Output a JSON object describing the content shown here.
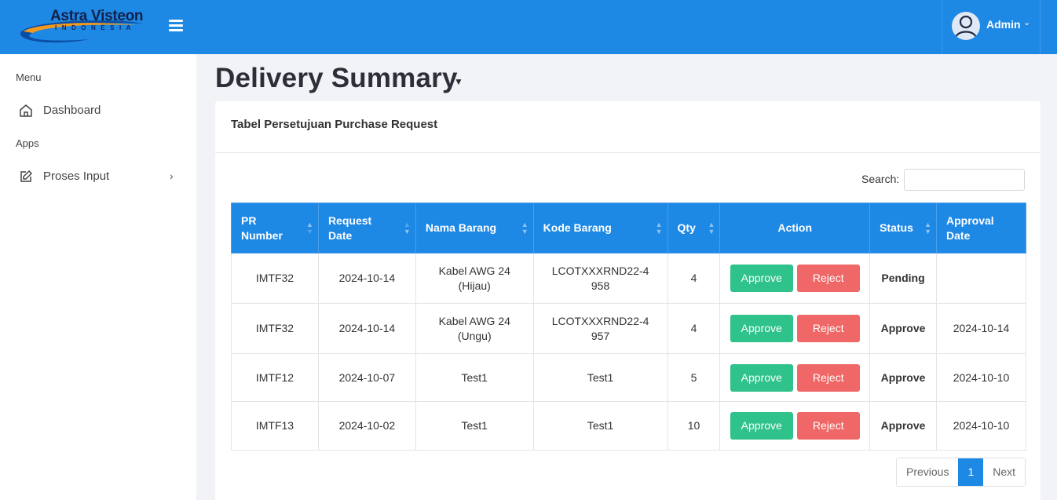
{
  "brand": {
    "name": "Astra Visteon",
    "sub": "INDONESIA"
  },
  "header": {
    "user": "Admin",
    "user_caret": "⌄"
  },
  "sidebar": {
    "menu_header": "Menu",
    "apps_header": "Apps",
    "items": [
      {
        "label": "Dashboard",
        "icon": "home-icon"
      },
      {
        "label": "Proses Input",
        "icon": "edit-icon",
        "chevron": "›"
      }
    ]
  },
  "page": {
    "title": "Delivery Summary",
    "title_caret": "▼"
  },
  "card": {
    "title": "Tabel Persetujuan Purchase Request",
    "search_label": "Search:",
    "search_value": ""
  },
  "table": {
    "columns": [
      {
        "label": "PR Number"
      },
      {
        "label": "Request Date"
      },
      {
        "label": "Nama Barang"
      },
      {
        "label": "Kode Barang"
      },
      {
        "label": "Qty"
      },
      {
        "label": "Action"
      },
      {
        "label": "Status"
      },
      {
        "label": "Approval Date"
      }
    ],
    "rows": [
      {
        "pr": "IMTF32",
        "date": "2024-10-14",
        "nama": "Kabel AWG 24 (Hijau)",
        "kode": "LCOTXXXRND22-4958",
        "qty": "4",
        "approve": "Approve",
        "reject": "Reject",
        "status": "Pending",
        "status_type": "pending",
        "approval_date": ""
      },
      {
        "pr": "IMTF32",
        "date": "2024-10-14",
        "nama": "Kabel AWG 24 (Ungu)",
        "kode": "LCOTXXXRND22-4957",
        "qty": "4",
        "approve": "Approve",
        "reject": "Reject",
        "status": "Approve",
        "status_type": "approve",
        "approval_date": "2024-10-14"
      },
      {
        "pr": "IMTF12",
        "date": "2024-10-07",
        "nama": "Test1",
        "kode": "Test1",
        "qty": "5",
        "approve": "Approve",
        "reject": "Reject",
        "status": "Approve",
        "status_type": "approve",
        "approval_date": "2024-10-10"
      },
      {
        "pr": "IMTF13",
        "date": "2024-10-02",
        "nama": "Test1",
        "kode": "Test1",
        "qty": "10",
        "approve": "Approve",
        "reject": "Reject",
        "status": "Approve",
        "status_type": "approve",
        "approval_date": "2024-10-10"
      }
    ]
  },
  "pagination": {
    "previous": "Previous",
    "current": "1",
    "next": "Next"
  },
  "colors": {
    "primary": "#1e88e5",
    "approve_btn": "#2fc28a",
    "reject_btn": "#ef6766",
    "status_approve": "#1a8a1a"
  }
}
